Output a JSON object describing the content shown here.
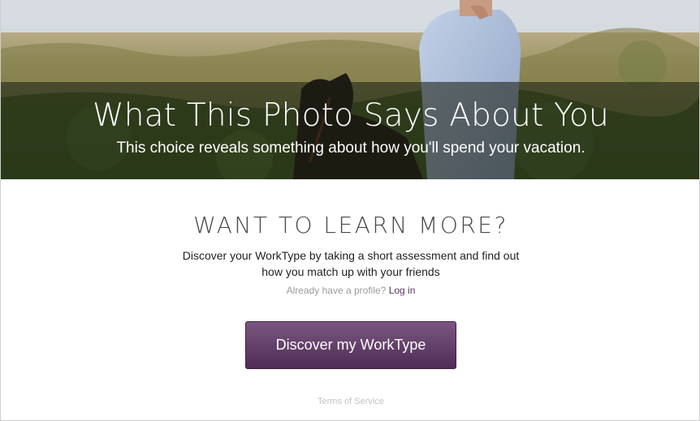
{
  "hero": {
    "title": "What This Photo Says About You",
    "subtitle": "This choice reveals something about how you'll spend your vacation."
  },
  "learn_more": {
    "heading": "WANT TO LEARN MORE?",
    "description": "Discover your WorkType by taking a short assessment and find out how you match up with your friends",
    "profile_prompt": "Already have a profile?",
    "login_label": "Log in"
  },
  "cta": {
    "label": "Discover my WorkType"
  },
  "footer": {
    "terms_label": "Terms of Service"
  },
  "colors": {
    "accent_purple": "#5b3063",
    "button_top": "#7a5780",
    "button_bottom": "#4f2c55"
  }
}
